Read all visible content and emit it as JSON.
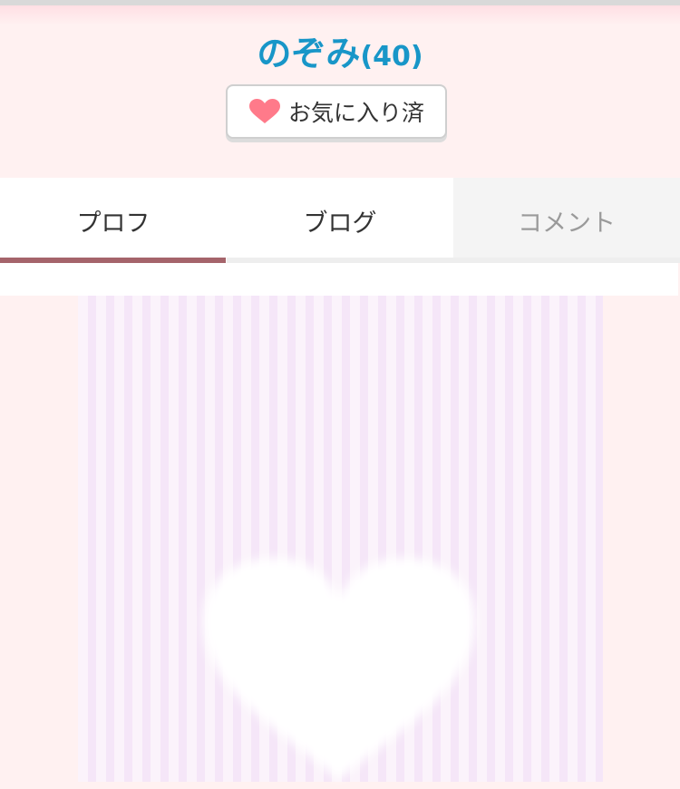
{
  "profile": {
    "name": "のぞみ",
    "age": "(40)"
  },
  "favorite_button": {
    "label": "お気に入り済",
    "icon": "heart-icon",
    "icon_color": "#ff7a8a"
  },
  "tabs": [
    {
      "label": "プロフ",
      "state": "active"
    },
    {
      "label": "ブログ",
      "state": "normal"
    },
    {
      "label": "コメント",
      "state": "inactive"
    }
  ],
  "photo": {
    "placeholder_icon": "heart-icon"
  },
  "colors": {
    "name": "#1896c8",
    "tab_underline": "#a5646b",
    "background": "#fff1f1"
  }
}
